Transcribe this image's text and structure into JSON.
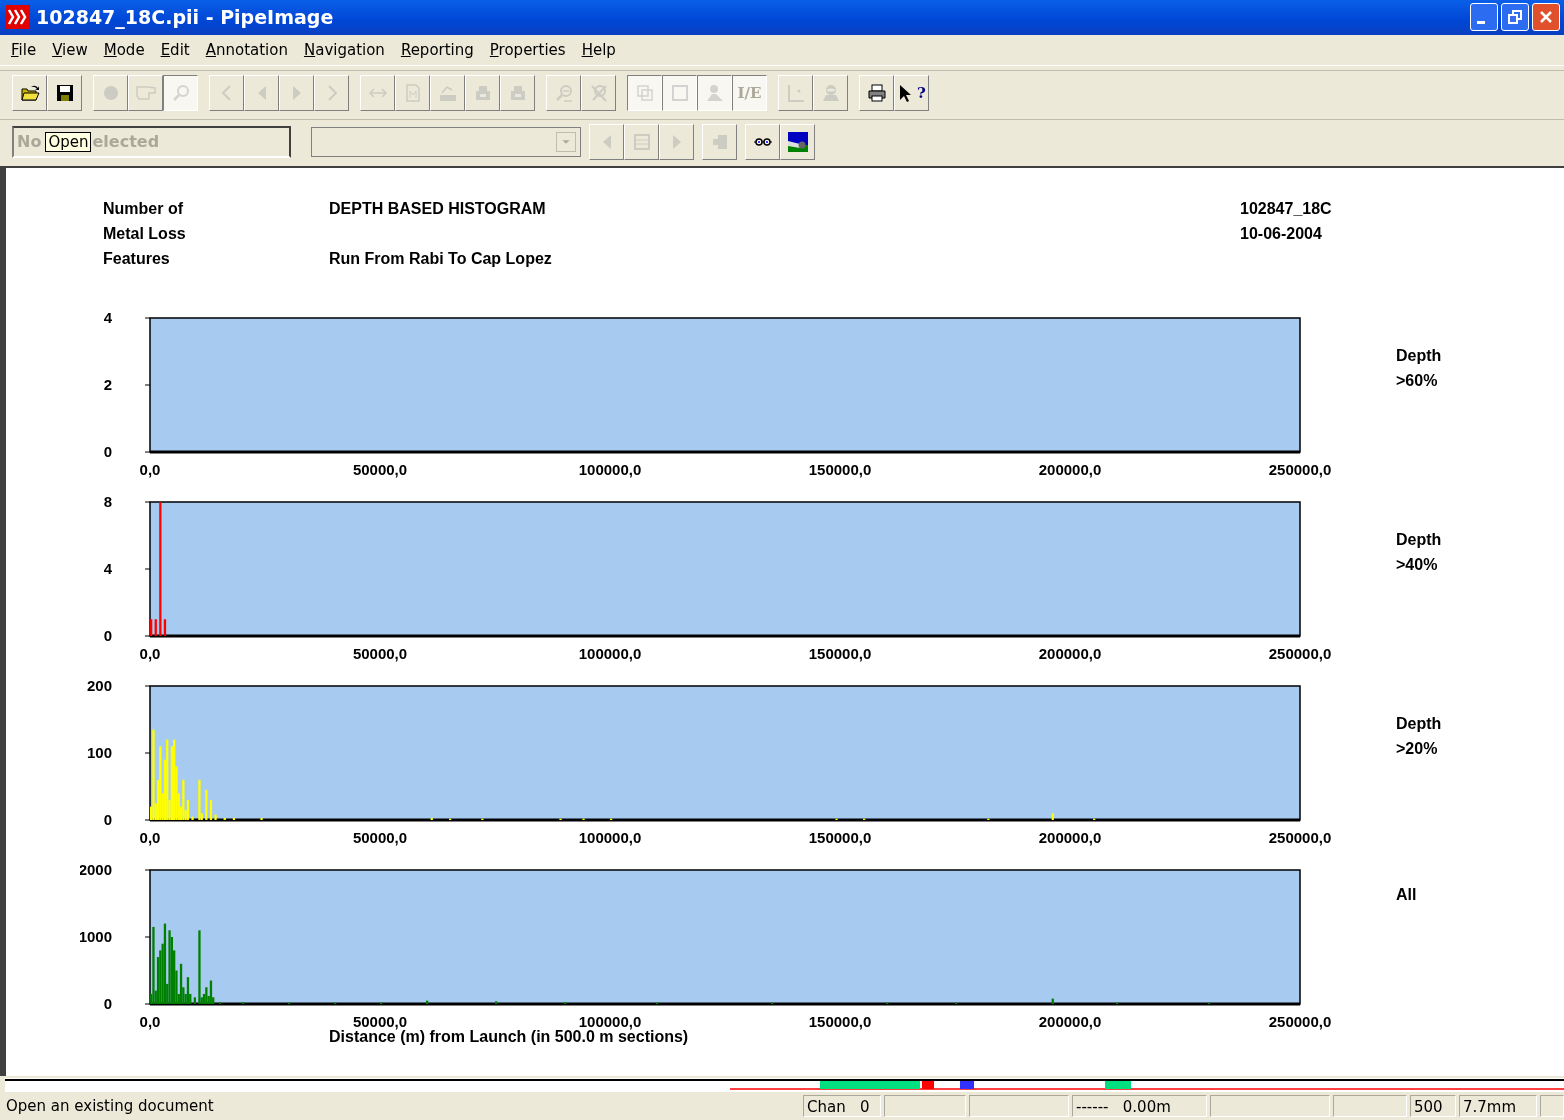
{
  "window": {
    "title": "102847_18C.pii - PipeImage"
  },
  "menu": [
    {
      "label": "File"
    },
    {
      "label": "View"
    },
    {
      "label": "Mode"
    },
    {
      "label": "Edit"
    },
    {
      "label": "Annotation"
    },
    {
      "label": "Navigation"
    },
    {
      "label": "Reporting"
    },
    {
      "label": "Properties"
    },
    {
      "label": "Help"
    }
  ],
  "toolbar": [
    [
      {
        "disabled": false,
        "pressed": false
      },
      {
        "disabled": false,
        "pressed": false
      }
    ],
    [
      {
        "disabled": true,
        "pressed": false
      },
      {
        "disabled": true,
        "pressed": false
      },
      {
        "disabled": true,
        "pressed": true
      }
    ],
    [
      {
        "disabled": true,
        "pressed": false
      },
      {
        "disabled": true,
        "pressed": false
      },
      {
        "disabled": true,
        "pressed": false
      },
      {
        "disabled": true,
        "pressed": false
      }
    ],
    [
      {
        "disabled": true,
        "pressed": false
      },
      {
        "disabled": true,
        "pressed": false
      },
      {
        "disabled": true,
        "pressed": false
      },
      {
        "disabled": true,
        "pressed": false
      },
      {
        "disabled": true,
        "pressed": false
      }
    ],
    [
      {
        "disabled": true,
        "pressed": false
      },
      {
        "disabled": true,
        "pressed": false
      }
    ],
    [
      {
        "disabled": true,
        "pressed": true
      },
      {
        "disabled": true,
        "pressed": true
      },
      {
        "disabled": true,
        "pressed": true
      },
      {
        "disabled": true,
        "pressed": true,
        "label": "I/E"
      }
    ],
    [
      {
        "disabled": true,
        "pressed": false
      },
      {
        "disabled": true,
        "pressed": false
      }
    ],
    [
      {
        "disabled": false,
        "pressed": false
      },
      {
        "disabled": false,
        "pressed": false,
        "label": "?"
      }
    ]
  ],
  "selection_field": {
    "visible_parts": [
      "No",
      "elected"
    ],
    "tooltip": "Open"
  },
  "combo": {
    "disabled": true
  },
  "toolbar2": [
    [
      {
        "disabled": true,
        "pressed": false
      },
      {
        "disabled": true,
        "pressed": false
      },
      {
        "disabled": true,
        "pressed": false
      }
    ],
    [
      {
        "disabled": true,
        "pressed": false
      }
    ],
    [
      {
        "disabled": false,
        "pressed": false
      },
      {
        "disabled": false,
        "pressed": false
      }
    ]
  ],
  "report": {
    "left_heading": [
      "Number of",
      "Metal Loss",
      "Features"
    ],
    "title": "DEPTH BASED HISTOGRAM",
    "subtitle": "Run From Rabi To Cap Lopez",
    "run_id": "102847_18C",
    "date": "10-06-2004",
    "charts": [
      {
        "label": "Depth\n>60%",
        "chart_data": {
          "type": "bar",
          "xlim": [
            0,
            250000
          ],
          "ylim": [
            0,
            4
          ],
          "yticks": [
            0,
            2,
            4
          ],
          "xticks": [
            {
              "value": 0,
              "label": "0,0"
            },
            {
              "value": 50000,
              "label": "50000,0"
            },
            {
              "value": 100000,
              "label": "100000,0"
            },
            {
              "value": 150000,
              "label": "150000,0"
            },
            {
              "value": 200000,
              "label": "200000,0"
            },
            {
              "value": 250000,
              "label": "250000,0"
            }
          ]
        }
      },
      {
        "label": "Depth\n>40%",
        "chart_data": {
          "type": "bar",
          "xlim": [
            0,
            250000
          ],
          "ylim": [
            0,
            8
          ],
          "yticks": [
            0,
            4,
            8
          ],
          "xticks": [
            {
              "value": 0,
              "label": "0,0"
            },
            {
              "value": 50000,
              "label": "50000,0"
            },
            {
              "value": 100000,
              "label": "100000,0"
            },
            {
              "value": 150000,
              "label": "150000,0"
            },
            {
              "value": 200000,
              "label": "200000,0"
            },
            {
              "value": 250000,
              "label": "250000,0"
            }
          ],
          "series": [
            {
              "color": "#ff0000",
              "x": [
                0,
                1000,
                2000,
                3000
              ],
              "values": [
                1,
                1,
                8,
                1
              ]
            }
          ]
        }
      },
      {
        "label": "Depth\n>20%",
        "chart_data": {
          "type": "bar",
          "xlim": [
            0,
            250000
          ],
          "ylim": [
            0,
            200
          ],
          "yticks": [
            0,
            100,
            200
          ],
          "xticks": [
            {
              "value": 0,
              "label": "0,0"
            },
            {
              "value": 50000,
              "label": "50000,0"
            },
            {
              "value": 100000,
              "label": "100000,0"
            },
            {
              "value": 150000,
              "label": "150000,0"
            },
            {
              "value": 200000,
              "label": "200000,0"
            },
            {
              "value": 250000,
              "label": "250000,0"
            }
          ],
          "series": [
            {
              "color": "#ffff00",
              "x": [
                0,
                500,
                1000,
                1500,
                2000,
                2500,
                3000,
                3500,
                4000,
                4500,
                5000,
                5500,
                6000,
                6500,
                7000,
                7500,
                8000,
                9000,
                10500,
                11000,
                12000,
                13000,
                14000,
                16000,
                18000,
                24000,
                61000,
                65000,
                72000,
                89000,
                94000,
                100000,
                149000,
                155000,
                182000,
                196000,
                205000
              ],
              "values": [
                20,
                135,
                25,
                60,
                110,
                40,
                90,
                120,
                30,
                110,
                120,
                80,
                40,
                20,
                60,
                15,
                30,
                5,
                60,
                10,
                45,
                30,
                8,
                3,
                3,
                3,
                3,
                2,
                2,
                2,
                2,
                2,
                2,
                2,
                2,
                10,
                2
              ]
            }
          ]
        }
      },
      {
        "label": "All",
        "chart_data": {
          "type": "bar",
          "xlim": [
            0,
            250000
          ],
          "ylim": [
            0,
            2000
          ],
          "yticks": [
            0,
            1000,
            2000
          ],
          "xlabel": "Distance (m) from Launch (in 500.0 m sections)",
          "xticks": [
            {
              "value": 0,
              "label": "0,0"
            },
            {
              "value": 50000,
              "label": "50000,0"
            },
            {
              "value": 100000,
              "label": "100000,0"
            },
            {
              "value": 150000,
              "label": "150000,0"
            },
            {
              "value": 200000,
              "label": "200000,0"
            },
            {
              "value": 250000,
              "label": "250000,0"
            }
          ],
          "series": [
            {
              "color": "#008000",
              "x": [
                0,
                500,
                1000,
                1500,
                2000,
                2500,
                3000,
                3500,
                4000,
                4500,
                5000,
                5500,
                6000,
                6500,
                7000,
                7500,
                8000,
                8500,
                9500,
                10500,
                11000,
                11500,
                12000,
                12500,
                13000,
                13500,
                15000,
                20000,
                30000,
                40000,
                50000,
                60000,
                75000,
                90000,
                110000,
                135000,
                160000,
                175000,
                196000,
                210000,
                230000
              ],
              "values": [
                150,
                1150,
                200,
                700,
                800,
                900,
                1200,
                300,
                1100,
                1000,
                800,
                500,
                150,
                600,
                250,
                150,
                400,
                150,
                100,
                1100,
                100,
                150,
                250,
                120,
                350,
                100,
                30,
                30,
                20,
                20,
                20,
                50,
                40,
                30,
                20,
                20,
                20,
                20,
                80,
                20,
                20
              ]
            }
          ]
        }
      }
    ]
  },
  "status_bar": {
    "message": "Open an existing document",
    "panes": [
      {
        "kind": "text",
        "text": "Chan   0"
      },
      {
        "kind": "empty"
      },
      {
        "kind": "empty"
      },
      {
        "kind": "text",
        "text": "------   0.00m"
      },
      {
        "kind": "empty"
      },
      {
        "kind": "empty"
      },
      {
        "kind": "text",
        "text": "500"
      },
      {
        "kind": "text",
        "text": "7.7mm"
      },
      {
        "kind": "empty"
      }
    ]
  }
}
